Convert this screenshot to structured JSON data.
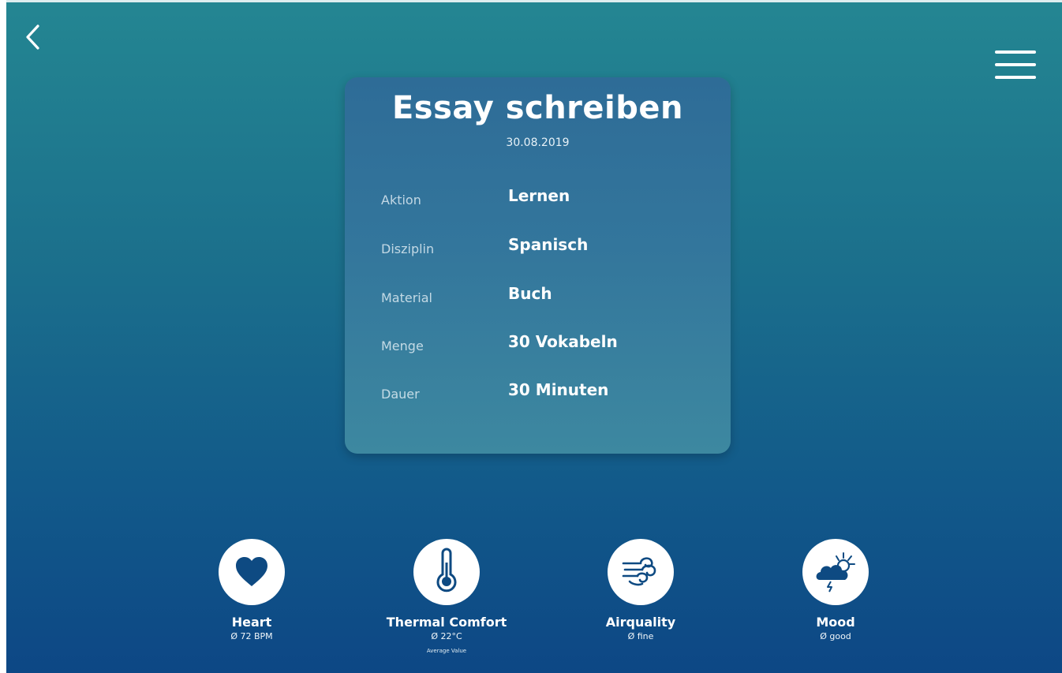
{
  "header": {
    "back_icon": "chevron-left-icon",
    "menu_icon": "hamburger-menu-icon"
  },
  "card": {
    "title": "Essay schreiben",
    "date": "30.08.2019",
    "rows": [
      {
        "label": "Aktion",
        "value": "Lernen"
      },
      {
        "label": "Disziplin",
        "value": "Spanisch"
      },
      {
        "label": "Material",
        "value": "Buch"
      },
      {
        "label": "Menge",
        "value": "30 Vokabeln"
      },
      {
        "label": "Dauer",
        "value": "30 Minuten"
      }
    ]
  },
  "metrics": [
    {
      "icon": "heart-icon",
      "label": "Heart",
      "value": "Ø 72 BPM",
      "sub": ""
    },
    {
      "icon": "thermometer-icon",
      "label": "Thermal Comfort",
      "value": "Ø 22°C",
      "sub": "Average Value"
    },
    {
      "icon": "wind-icon",
      "label": "Airquality",
      "value": "Ø fine",
      "sub": ""
    },
    {
      "icon": "storm-cloud-sun-icon",
      "label": "Mood",
      "value": "Ø good",
      "sub": ""
    }
  ],
  "colors": {
    "background_top": "#248692",
    "background_bottom": "#0d4785",
    "card": "#33769c",
    "icon": "#0e4a82"
  }
}
